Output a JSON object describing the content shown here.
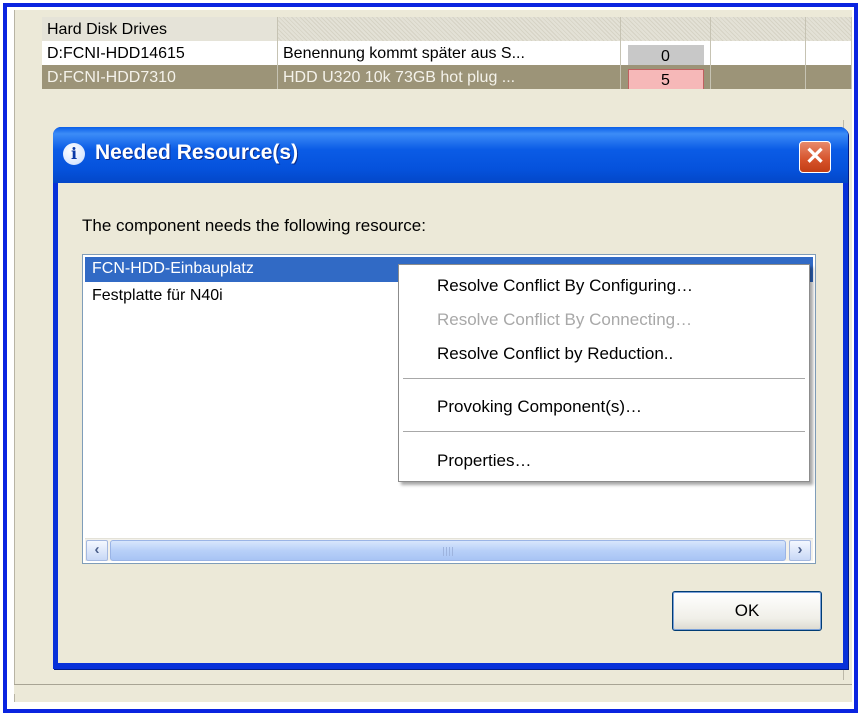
{
  "grid": {
    "header_label": "Hard Disk Drives",
    "rows": [
      {
        "id": "D:FCNI-HDD14615",
        "description": "Benennung kommt später aus S...",
        "count": "0"
      },
      {
        "id": "D:FCNI-HDD7310",
        "description": "HDD U320 10k  73GB hot plug ...",
        "count": "5"
      }
    ]
  },
  "dialog": {
    "title": "Needed Resource(s)",
    "close_glyph": "✕",
    "info_glyph": "i",
    "prompt": "The component needs the following resource:",
    "resources": [
      {
        "label": "FCN-HDD-Einbauplatz",
        "selected": true
      },
      {
        "label": "Festplatte für N40i",
        "selected": false
      }
    ],
    "ok_label": "OK"
  },
  "context_menu": {
    "items": [
      {
        "label": "Resolve Conflict By Configuring…",
        "enabled": true
      },
      {
        "label": "Resolve Conflict By Connecting…",
        "enabled": false
      },
      {
        "label": "Resolve Conflict by Reduction..",
        "enabled": true
      },
      {
        "label": "Provoking Component(s)…",
        "enabled": true
      },
      {
        "label": "Properties…",
        "enabled": true
      }
    ]
  },
  "colors": {
    "frame_border": "#0a24e0",
    "selection": "#316ac5",
    "count_alert": "#f6b8b8",
    "titlebar": "#0552dc"
  },
  "icons": {
    "title_icon": "info-icon",
    "close": "close-icon",
    "scroll_left": "scroll-left-arrow-icon",
    "scroll_right": "scroll-right-arrow-icon"
  }
}
